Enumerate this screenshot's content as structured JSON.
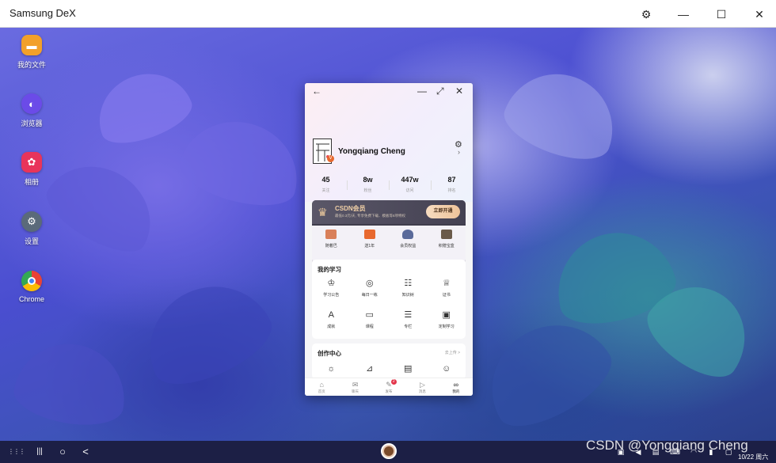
{
  "window": {
    "title": "Samsung DeX"
  },
  "window_controls": {
    "settings": "⚙",
    "minimize": "—",
    "maximize": "☐",
    "close": "✕"
  },
  "desktop_icons": [
    {
      "label": "我的文件",
      "icon": "folder-icon",
      "color": "#f2a02a"
    },
    {
      "label": "浏览器",
      "icon": "browser-icon",
      "color": "#6b4be8"
    },
    {
      "label": "相册",
      "icon": "gallery-icon",
      "color": "#e8345a"
    },
    {
      "label": "设置",
      "icon": "gear-icon",
      "color": "#5a6a7a"
    },
    {
      "label": "Chrome",
      "icon": "chrome-icon",
      "color": "#ffffff"
    }
  ],
  "app": {
    "topbar": {
      "back": "←",
      "minimize": "—",
      "expand": "⤢",
      "close": "✕"
    },
    "profile": {
      "name": "Yongqiang Cheng"
    },
    "stats": [
      {
        "value": "45",
        "label": "关注"
      },
      {
        "value": "8w",
        "label": "粉丝"
      },
      {
        "value": "447w",
        "label": "访问"
      },
      {
        "value": "87",
        "label": "排名"
      }
    ],
    "vip": {
      "title": "CSDN会员",
      "subtitle": "最低0.3元/天, 专享免费下载、模板等8项特权",
      "button": "立即开通",
      "items": [
        {
          "label": "随着巴",
          "color": "#d9805a"
        },
        {
          "label": "送1年",
          "color": "#e8692f"
        },
        {
          "label": "会员权益",
          "color": "#5a6a9a"
        },
        {
          "label": "积赠宝盒",
          "color": "#6a5a4a"
        }
      ]
    },
    "learning": {
      "title": "我的学习",
      "items": [
        {
          "label": "学习公告",
          "icon": "♔"
        },
        {
          "label": "每日一练",
          "icon": "◎"
        },
        {
          "label": "知识树",
          "icon": "☷"
        },
        {
          "label": "证书",
          "icon": "♕"
        },
        {
          "label": "成就",
          "icon": "A"
        },
        {
          "label": "课程",
          "icon": "▭"
        },
        {
          "label": "专栏",
          "icon": "☰"
        },
        {
          "label": "定制学习",
          "icon": "▣"
        }
      ]
    },
    "creation": {
      "title": "创作中心",
      "more": "去上传 >",
      "items": [
        {
          "icon": "☼"
        },
        {
          "icon": "⊿"
        },
        {
          "icon": "▤"
        },
        {
          "icon": "☺"
        }
      ]
    },
    "bottom_nav": [
      {
        "label": "首页",
        "icon": "⌂",
        "active": false
      },
      {
        "label": "聊天",
        "icon": "✉",
        "active": false
      },
      {
        "label": "发布",
        "icon": "✎",
        "active": false,
        "badge": "2"
      },
      {
        "label": "消息",
        "icon": "▷",
        "active": false
      },
      {
        "label": "我的",
        "icon": "∞",
        "active": true
      }
    ]
  },
  "taskbar": {
    "apps_icon": "⋮⋮⋮",
    "recents": "|||",
    "home": "○",
    "back": "<",
    "clock": "10/22 周六"
  },
  "watermark": "CSDN @Yongqiang Cheng"
}
